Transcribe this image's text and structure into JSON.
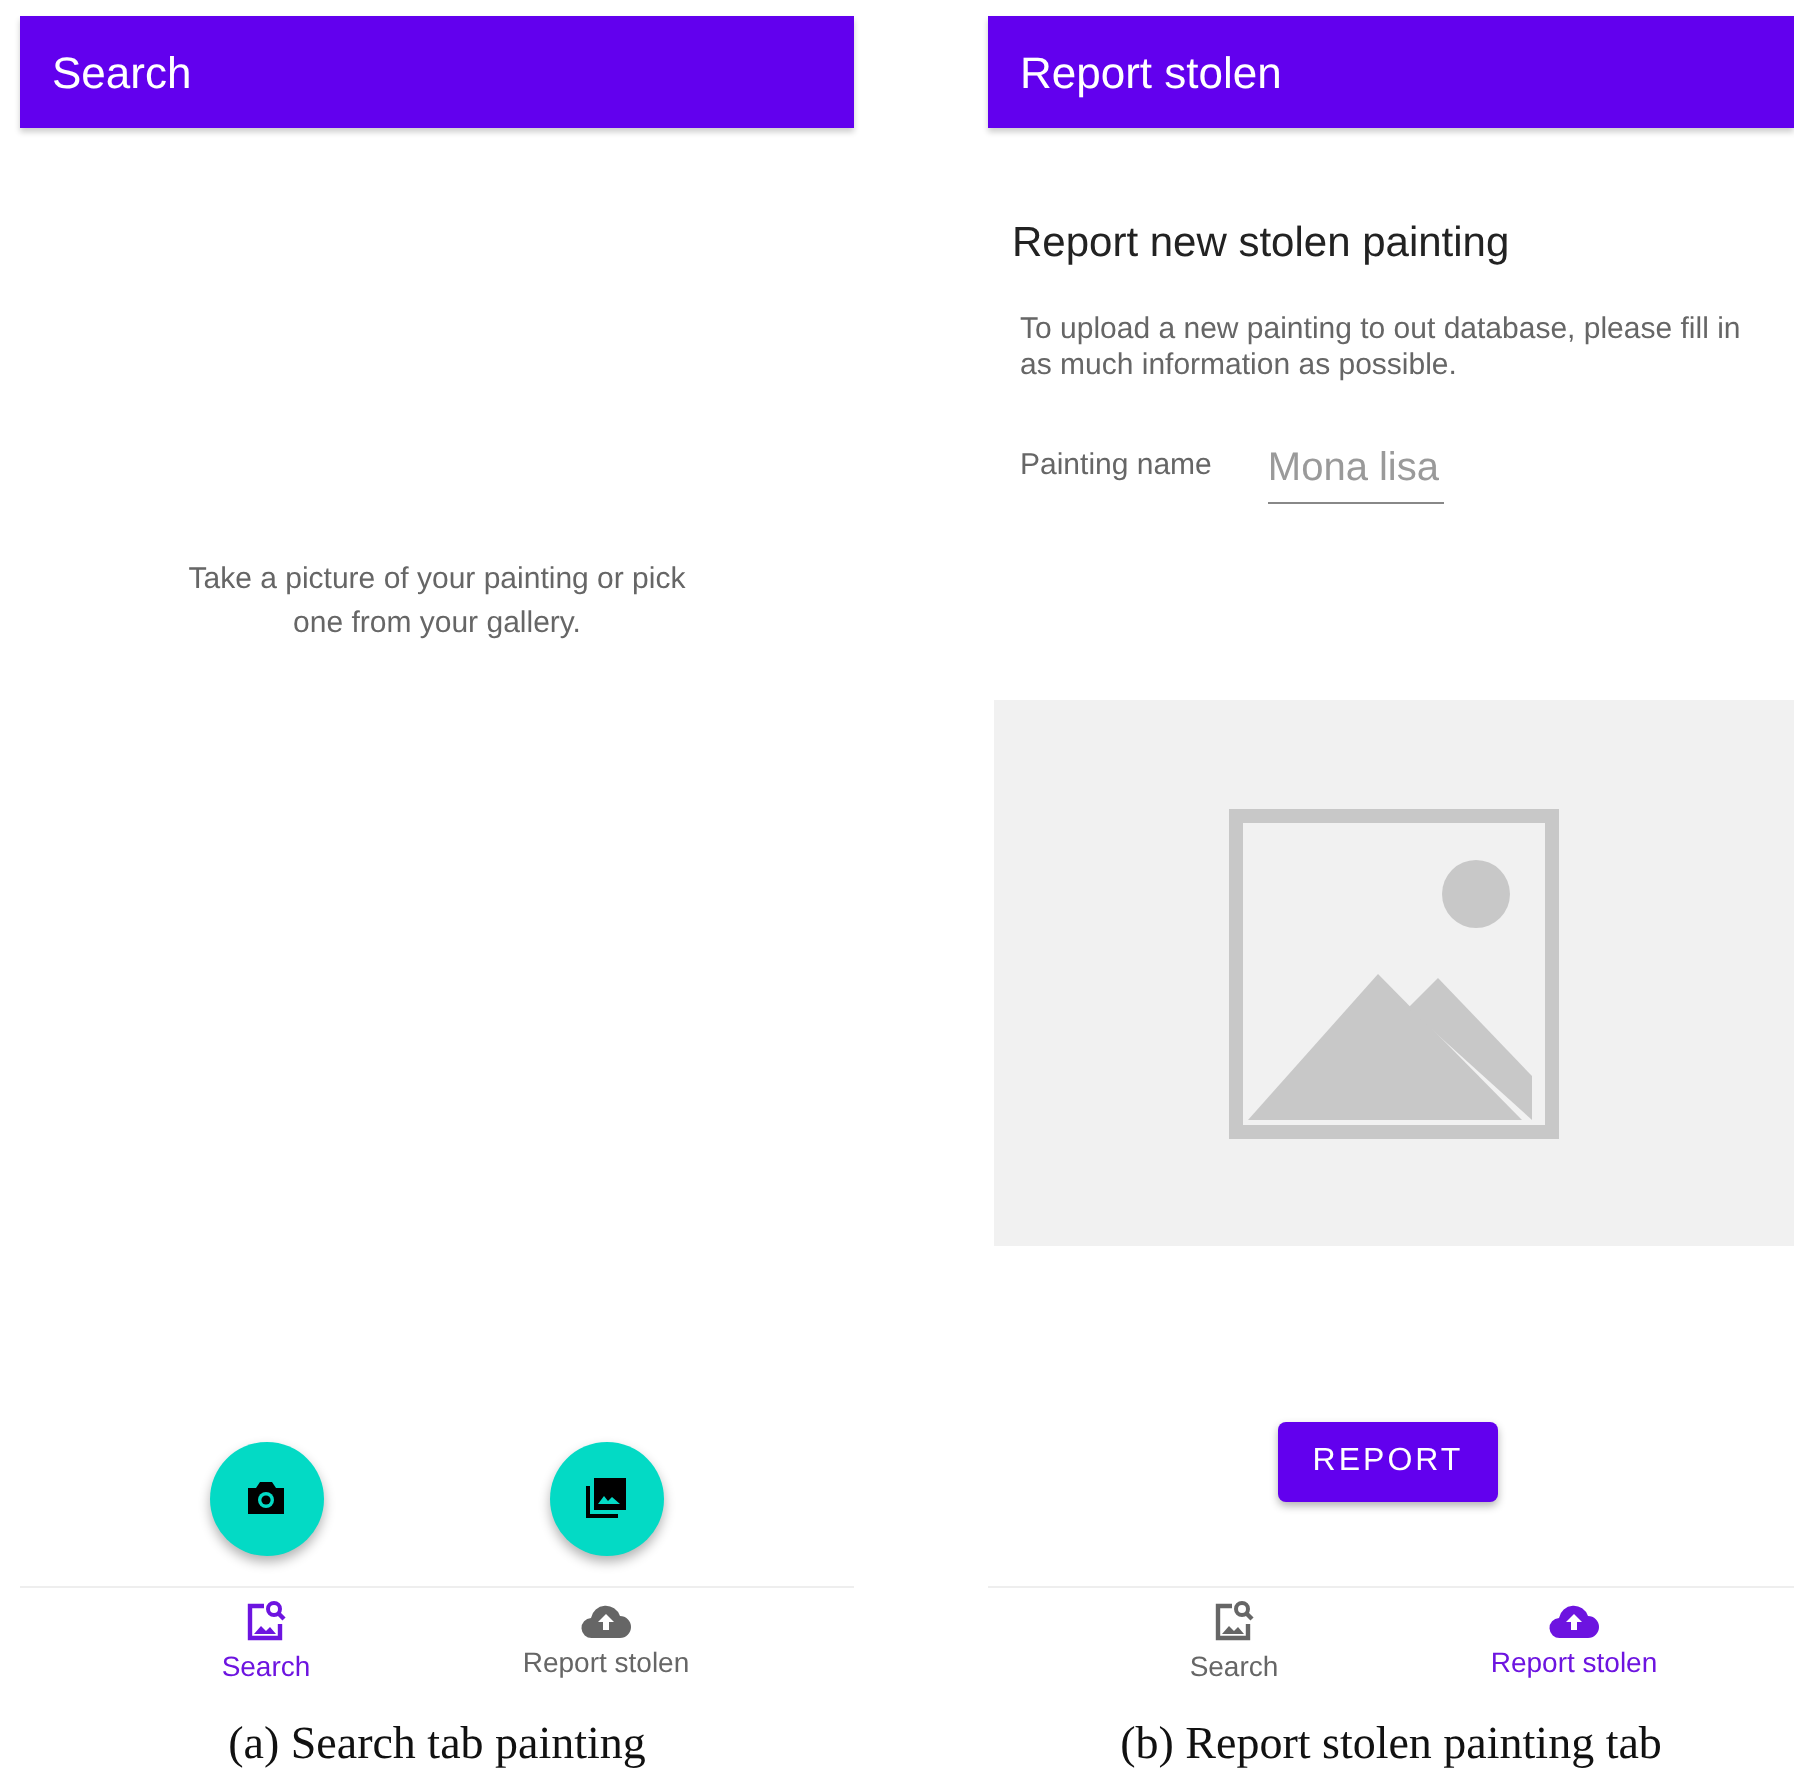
{
  "panels": [
    {
      "kind": "search",
      "app_bar": {
        "title": "Search"
      },
      "message": "Take a picture of your painting or pick one from your gallery.",
      "fabs": [
        {
          "kind": "camera"
        },
        {
          "kind": "gallery"
        }
      ],
      "nav": [
        {
          "label": "Search",
          "kind": "search",
          "selected": true
        },
        {
          "label": "Report stolen",
          "kind": "upload",
          "selected": false
        }
      ],
      "caption": "(a) Search tab painting"
    },
    {
      "kind": "report",
      "app_bar": {
        "title": "Report stolen"
      },
      "heading": "Report new stolen painting",
      "description": "To upload a new painting to out database, please fill in as much information as possible.",
      "field": {
        "label": "Painting name",
        "placeholder": "Mona lisa"
      },
      "button": "REPORT",
      "nav": [
        {
          "label": "Search",
          "kind": "search",
          "selected": false
        },
        {
          "label": "Report stolen",
          "kind": "upload",
          "selected": true
        }
      ],
      "caption": "(b) Report stolen painting tab"
    }
  ]
}
